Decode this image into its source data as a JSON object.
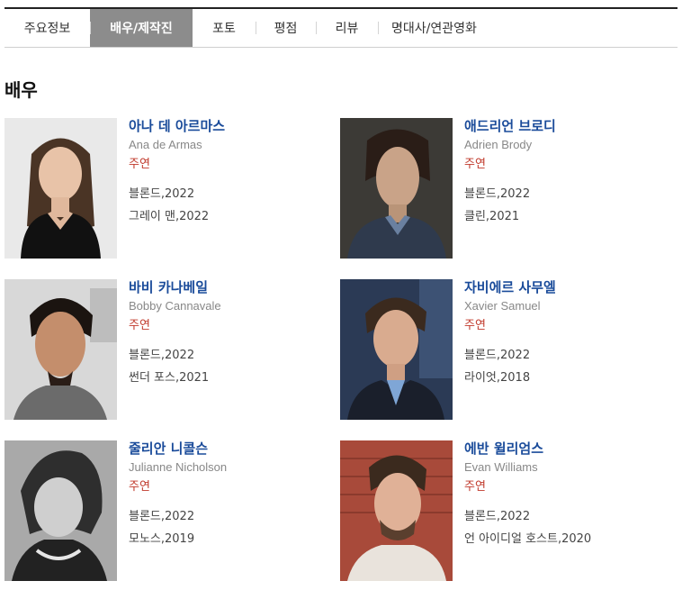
{
  "tabs": [
    {
      "label": "주요정보",
      "active": false
    },
    {
      "label": "배우/제작진",
      "active": true
    },
    {
      "label": "포토",
      "active": false
    },
    {
      "label": "평점",
      "active": false
    },
    {
      "label": "리뷰",
      "active": false
    },
    {
      "label": "명대사/연관영화",
      "active": false
    }
  ],
  "section_title": "배우",
  "actors": [
    {
      "name_ko": "아나 데 아르마스",
      "name_en": "Ana de Armas",
      "role": "주연",
      "works": [
        "블론드,2022",
        "그레이 맨,2022"
      ]
    },
    {
      "name_ko": "애드리언 브로디",
      "name_en": "Adrien Brody",
      "role": "주연",
      "works": [
        "블론드,2022",
        "클린,2021"
      ]
    },
    {
      "name_ko": "바비 카나베일",
      "name_en": "Bobby Cannavale",
      "role": "주연",
      "works": [
        "블론드,2022",
        "썬더 포스,2021"
      ]
    },
    {
      "name_ko": "자비에르 사무엘",
      "name_en": "Xavier Samuel",
      "role": "주연",
      "works": [
        "블론드,2022",
        "라이엇,2018"
      ]
    },
    {
      "name_ko": "줄리안 니콜슨",
      "name_en": "Julianne Nicholson",
      "role": "주연",
      "works": [
        "블론드,2022",
        "모노스,2019"
      ]
    },
    {
      "name_ko": "에반 윌리엄스",
      "name_en": "Evan Williams",
      "role": "주연",
      "works": [
        "블론드,2022",
        "언 아이디얼 호스트,2020"
      ]
    }
  ]
}
